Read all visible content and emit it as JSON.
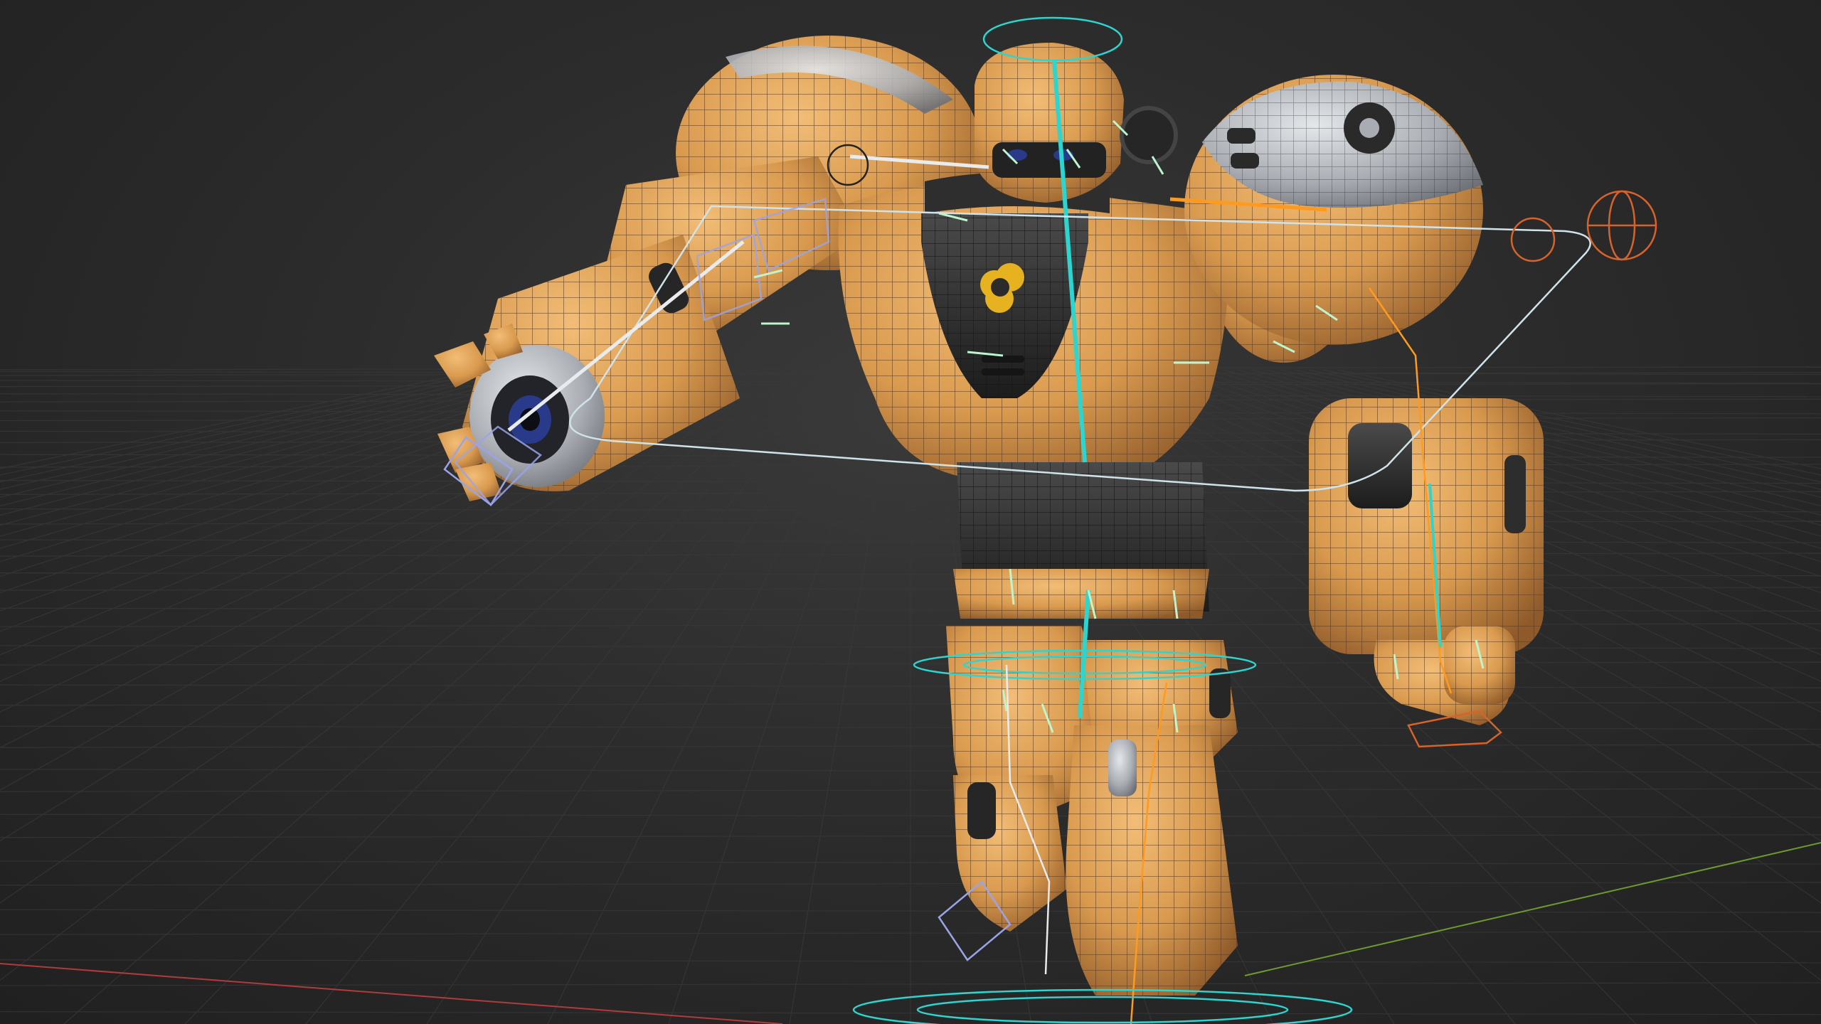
{
  "viewport": {
    "view": "3d-viewport",
    "background_color": "#2b2b2b",
    "grid": {
      "visible": true,
      "color": "#3a3a3a"
    },
    "axes": {
      "x_color": "#b33a3a",
      "y_color": "#6f9a2d"
    }
  },
  "scene": {
    "object": "robot-mesh",
    "display": {
      "wireframe_overlay": true,
      "armature_visible": true
    },
    "colors": {
      "armor": "#d99a4e",
      "armor_shadow": "#9a6330",
      "dark_metal": "#3a3a3a",
      "steel": "#a9adb3",
      "wire": "#5a3a1f",
      "bone_white": "#e8ecef",
      "bone_cyan": "#2ad6cf",
      "bone_orange": "#ff9a1f",
      "ik_control": "#d9622a",
      "bone_lilac": "#9aa3e8",
      "emblem": "#e6b21f"
    }
  }
}
